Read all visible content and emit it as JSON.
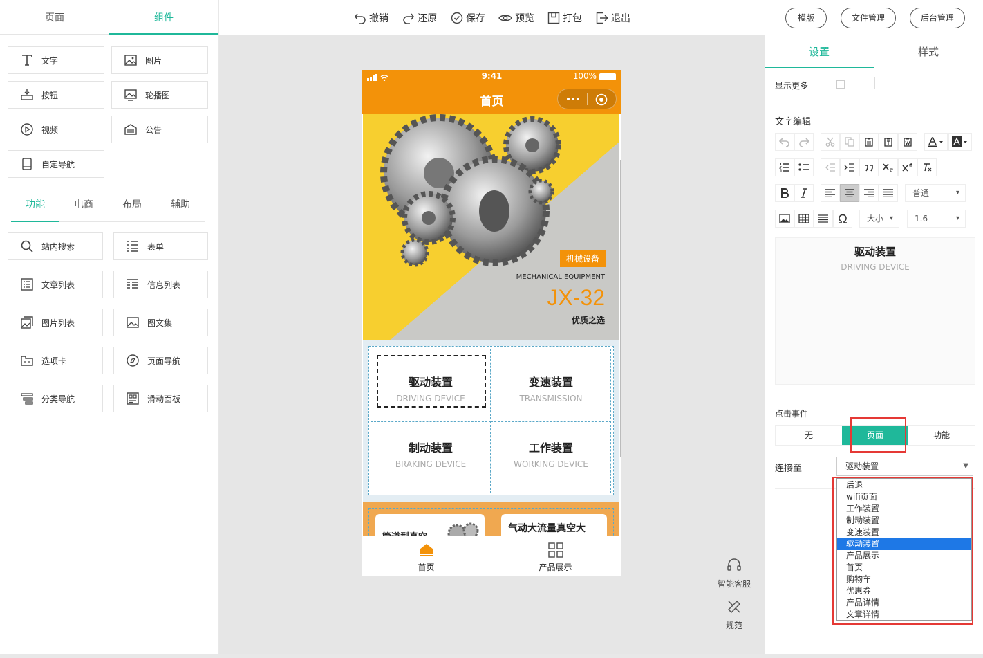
{
  "left_panel": {
    "tabs": [
      "页面",
      "组件"
    ],
    "components": [
      {
        "label": "文字",
        "icon": "text-icon"
      },
      {
        "label": "图片",
        "icon": "image-icon"
      },
      {
        "label": "按钮",
        "icon": "button-icon"
      },
      {
        "label": "轮播图",
        "icon": "carousel-icon"
      },
      {
        "label": "视频",
        "icon": "video-icon"
      },
      {
        "label": "公告",
        "icon": "notice-icon"
      },
      {
        "label": "自定导航",
        "icon": "nav-icon"
      }
    ],
    "func_tabs": [
      "功能",
      "电商",
      "布局",
      "辅助"
    ],
    "func_items": [
      {
        "label": "站内搜索",
        "icon": "search-icon"
      },
      {
        "label": "表单",
        "icon": "form-icon"
      },
      {
        "label": "文章列表",
        "icon": "article-list-icon"
      },
      {
        "label": "信息列表",
        "icon": "info-list-icon"
      },
      {
        "label": "图片列表",
        "icon": "image-list-icon"
      },
      {
        "label": "图文集",
        "icon": "gallery-icon"
      },
      {
        "label": "选项卡",
        "icon": "tabs-icon"
      },
      {
        "label": "页面导航",
        "icon": "compass-icon"
      },
      {
        "label": "分类导航",
        "icon": "category-icon"
      },
      {
        "label": "滑动面板",
        "icon": "slide-panel-icon"
      }
    ]
  },
  "toolbar": {
    "undo": "撤销",
    "redo": "还原",
    "save": "保存",
    "preview": "预览",
    "package": "打包",
    "exit": "退出"
  },
  "header_right": {
    "template": "模版",
    "file_manage": "文件管理",
    "backend_manage": "后台管理"
  },
  "phone": {
    "status_time": "9:41",
    "status_battery": "100%",
    "page_title": "首页",
    "banner": {
      "badge": "机械设备",
      "subtitle": "MECHANICAL EQUIPMENT",
      "model": "JX-32",
      "slogan": "优质之选"
    },
    "grid": [
      {
        "zh": "驱动装置",
        "en": "DRIVING DEVICE"
      },
      {
        "zh": "变速装置",
        "en": "TRANSMISSION"
      },
      {
        "zh": "制动装置",
        "en": "BRAKING DEVICE"
      },
      {
        "zh": "工作装置",
        "en": "WORKING DEVICE"
      }
    ],
    "products": [
      {
        "title": "管道型真空"
      },
      {
        "title": "气动大流量真空大"
      }
    ],
    "tabbar": [
      {
        "label": "首页"
      },
      {
        "label": "产品展示"
      }
    ]
  },
  "side_tools": {
    "service": "智能客服",
    "spec": "规范"
  },
  "settings": {
    "tabs": [
      "设置",
      "样式"
    ],
    "show_more_label": "显示更多",
    "text_edit_label": "文字编辑",
    "format_select": "普通",
    "size_select": "大小",
    "line_height_select": "1.6",
    "preview": {
      "zh": "驱动装置",
      "en": "DRIVING DEVICE"
    },
    "click_event_label": "点击事件",
    "click_options": [
      "无",
      "页面",
      "功能"
    ],
    "link_label": "连接至",
    "link_value": "驱动装置",
    "link_options": [
      "后退",
      "wifi页面",
      "工作装置",
      "制动装置",
      "变速装置",
      "驱动装置",
      "产品展示",
      "首页",
      "购物车",
      "优惠券",
      "产品详情",
      "文章详情"
    ],
    "link_selected_index": 5
  },
  "colors": {
    "accent": "#1fb89a",
    "phone_header": "#f39209",
    "highlight_red": "#e53935",
    "select_blue": "#1e78e6"
  }
}
